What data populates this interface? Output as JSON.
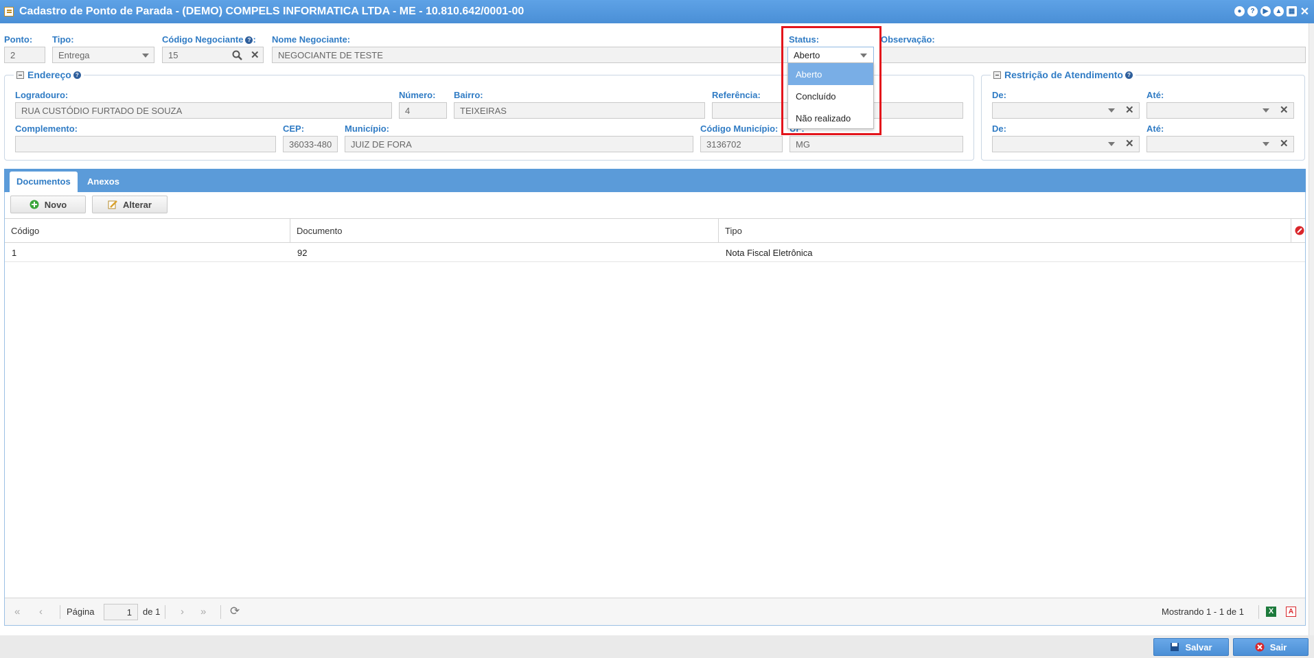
{
  "window": {
    "title": "Cadastro de Ponto de Parada - (DEMO) COMPELS INFORMATICA LTDA - ME - 10.810.642/0001-00",
    "controls": [
      "●",
      "?",
      "▶",
      "▲",
      "▦",
      "✕"
    ]
  },
  "header": {
    "ponto": {
      "label": "Ponto:",
      "value": "2"
    },
    "tipo": {
      "label": "Tipo:",
      "value": "Entrega"
    },
    "codigo_negociante": {
      "label": "Código Negociante",
      "value": "15"
    },
    "nome_negociante": {
      "label": "Nome Negociante:",
      "value": "NEGOCIANTE DE TESTE"
    },
    "status": {
      "label": "Status:",
      "value": "Aberto",
      "options": [
        "Aberto",
        "Concluído",
        "Não realizado"
      ]
    },
    "observacao": {
      "label": "Observação:",
      "value": ""
    }
  },
  "endereco": {
    "legend": "Endereço",
    "logradouro": {
      "label": "Logradouro:",
      "value": "RUA CUSTÓDIO FURTADO DE SOUZA"
    },
    "numero": {
      "label": "Número:",
      "value": "4"
    },
    "bairro": {
      "label": "Bairro:",
      "value": "TEIXEIRAS"
    },
    "referencia": {
      "label": "Referência:",
      "value": ""
    },
    "complemento": {
      "label": "Complemento:",
      "value": ""
    },
    "cep": {
      "label": "CEP:",
      "value": "36033-480"
    },
    "municipio": {
      "label": "Município:",
      "value": "JUIZ DE FORA"
    },
    "codigo_municipio": {
      "label": "Código Município:",
      "value": "3136702"
    },
    "uf": {
      "label": "UF:",
      "value": "MG"
    }
  },
  "restricao": {
    "legend": "Restrição de Atendimento",
    "rows": [
      {
        "de": "De:",
        "ate": "Até:"
      },
      {
        "de": "De:",
        "ate": "Até:"
      }
    ]
  },
  "tabs": [
    {
      "label": "Documentos"
    },
    {
      "label": "Anexos"
    }
  ],
  "toolbar": {
    "novo": "Novo",
    "alterar": "Alterar"
  },
  "grid": {
    "columns": [
      "Código",
      "Documento",
      "Tipo"
    ],
    "rows": [
      {
        "codigo": "1",
        "documento": "92",
        "tipo": "Nota Fiscal Eletrônica"
      }
    ]
  },
  "pager": {
    "page_label": "Página",
    "page": "1",
    "of": "de 1",
    "summary": "Mostrando 1 - 1 de 1"
  },
  "footer": {
    "salvar": "Salvar",
    "sair": "Sair"
  },
  "colors": {
    "accent": "#4a8fd6",
    "label": "#2f7bc4",
    "highlight": "#e3141b",
    "selected_option": "#79aee6"
  }
}
